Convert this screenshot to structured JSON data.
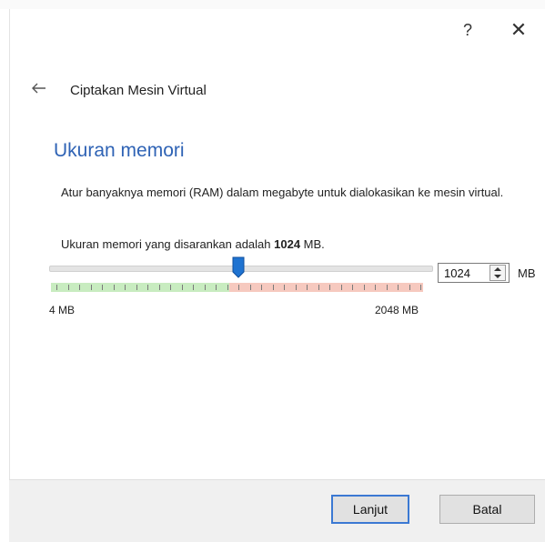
{
  "window": {
    "help_label": "?",
    "close_label": "✕",
    "title": "Ciptakan Mesin Virtual"
  },
  "page": {
    "heading": "Ukuran memori",
    "description": "Atur banyaknya memori (RAM) dalam megabyte untuk dialokasikan ke mesin virtual.",
    "recommended_prefix": "Ukuran memori yang disarankan adalah ",
    "recommended_value": "1024",
    "recommended_suffix": " MB."
  },
  "memory": {
    "value": "1024",
    "unit": "MB",
    "min_label": "4 MB",
    "max_label": "2048 MB",
    "min_mb": 4,
    "max_mb": 2048,
    "current_mb": 1024,
    "recommended_max_mb": 1024,
    "colors": {
      "safe_zone": "#c8ecc0",
      "warn_zone": "#f6c9bf",
      "handle": "#1f73d1"
    }
  },
  "buttons": {
    "next": "Lanjut",
    "cancel": "Batal"
  },
  "icons": {
    "back": "arrow-left-icon",
    "help": "question-icon",
    "close": "close-icon"
  }
}
